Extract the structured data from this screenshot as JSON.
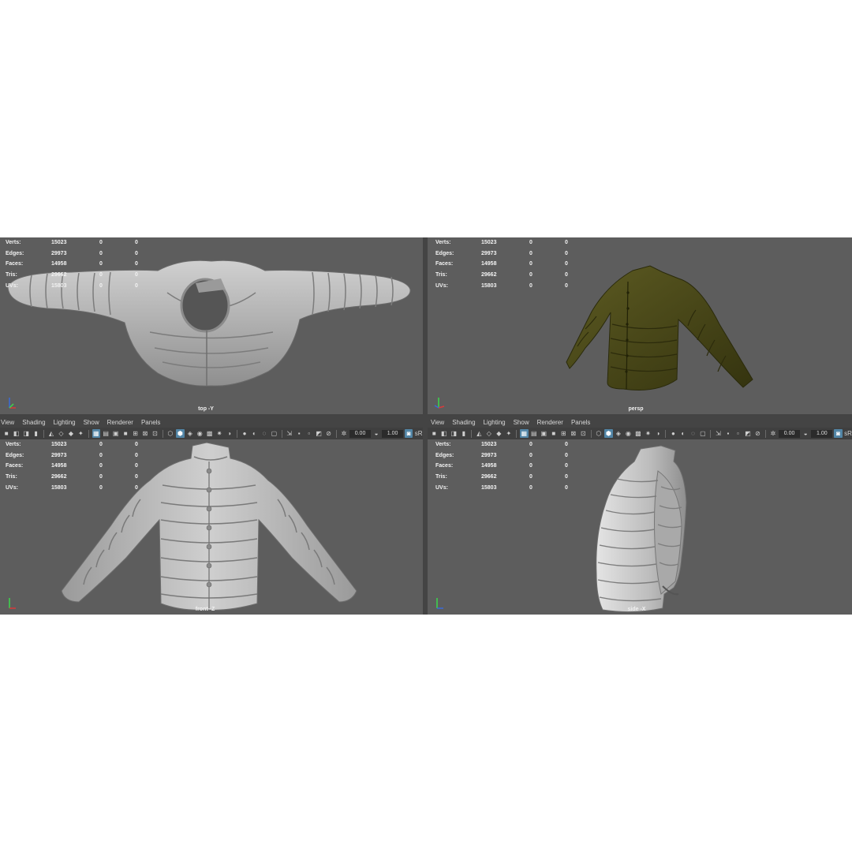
{
  "stats_labels": [
    "Verts:",
    "Edges:",
    "Faces:",
    "Tris:",
    "UVs:"
  ],
  "stats_rows": [
    {
      "label": "Verts:",
      "v1": "15023",
      "v2": "0",
      "v3": "0"
    },
    {
      "label": "Edges:",
      "v1": "29973",
      "v2": "0",
      "v3": "0"
    },
    {
      "label": "Faces:",
      "v1": "14958",
      "v2": "0",
      "v3": "0"
    },
    {
      "label": "Tris:",
      "v1": "29662",
      "v2": "0",
      "v3": "0"
    },
    {
      "label": "UVs:",
      "v1": "15803",
      "v2": "0",
      "v3": "0"
    }
  ],
  "viewports": {
    "top": {
      "camera": "top -Y"
    },
    "persp": {
      "camera": "persp"
    },
    "front": {
      "camera": "front -Z"
    },
    "side": {
      "camera": "side -X"
    }
  },
  "panel_menu": [
    "View",
    "Shading",
    "Lighting",
    "Show",
    "Renderer",
    "Panels"
  ],
  "toolbar": {
    "exposure": "0.00",
    "gamma": "1.00",
    "colorspace_label": "sR"
  },
  "colors": {
    "viewport_bg": "#5d5d5d",
    "model_gray": "#b9b9b9",
    "model_olive": "#4b4a1c",
    "toggle_active": "#5285a6"
  },
  "icons": [
    "camera-icon",
    "grid-icon",
    "wireframe-icon",
    "smooth-shade-icon",
    "textured-icon",
    "light-icon",
    "shadow-icon",
    "isolate-icon",
    "xray-icon",
    "exposure-icon",
    "gamma-icon"
  ]
}
